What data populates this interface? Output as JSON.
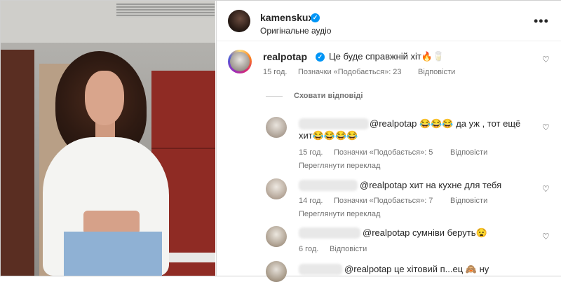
{
  "header": {
    "username": "kamenskux",
    "subtitle": "Оригінальне аудіо",
    "more_icon": "•••"
  },
  "main_comment": {
    "username": "realpotap",
    "text": "Це буде справжній хіт🔥🥛",
    "time": "15 год.",
    "likes": "Позначки «Подобається»: 23",
    "reply": "Відповісти"
  },
  "hide_replies": "Сховати відповіді",
  "replies": [
    {
      "line1": "@realpotap 😂😂😂 да уж , тот ещё",
      "line2": "хит😂😂😂😂",
      "time": "15 год.",
      "likes": "Позначки «Подобається»: 5",
      "reply": "Відповісти",
      "translate": "Переглянути переклад"
    },
    {
      "line1": "@realpotap хит на кухне для тебя",
      "time": "14 год.",
      "likes": "Позначки «Подобається»: 7",
      "reply": "Відповісти",
      "translate": "Переглянути переклад"
    },
    {
      "line1": "@realpotap сумніви беруть😧",
      "time": "6 год.",
      "reply": "Відповісти"
    },
    {
      "line1": "@realpotap це хітовий п...ец 🙈 ну"
    }
  ],
  "icons": {
    "verified": "✓",
    "heart": "♡"
  }
}
